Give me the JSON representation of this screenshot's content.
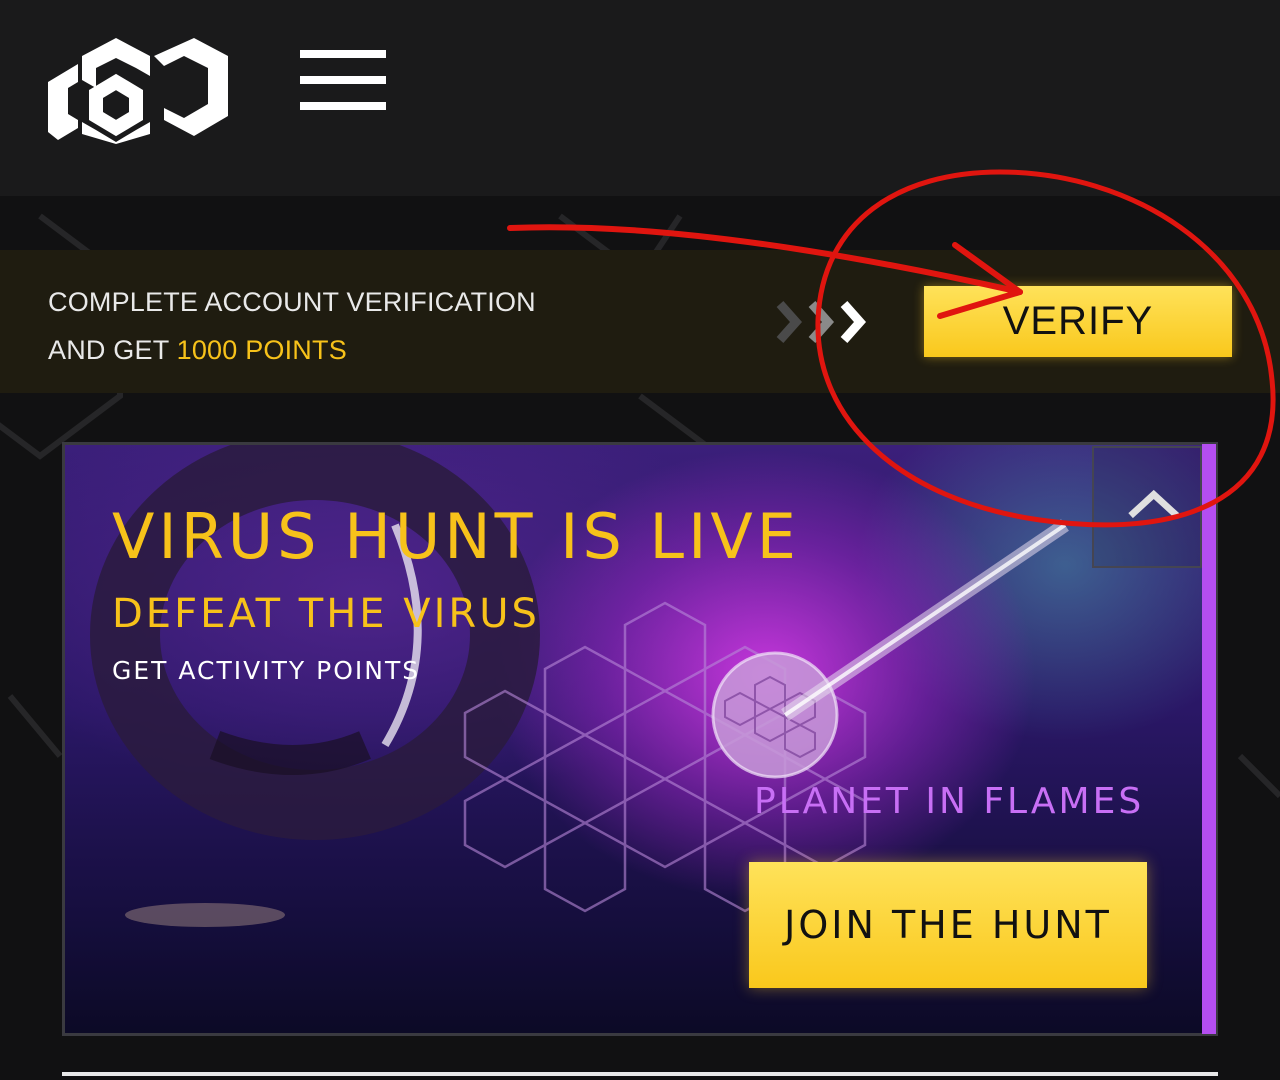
{
  "header": {
    "logo_icon": "brand-logo-icon",
    "menu_icon": "hamburger-menu-icon"
  },
  "verification_banner": {
    "line1": "COMPLETE ACCOUNT VERIFICATION",
    "line2_prefix": "AND GET ",
    "line2_points": "1000 POINTS",
    "chevrons_icon": "triple-chevron-right-icon",
    "button_label": "VERIFY"
  },
  "promo": {
    "title": "VIRUS HUNT IS LIVE",
    "subtitle": "DEFEAT THE VIRUS",
    "caption": "GET ACTIVITY POINTS",
    "game_name": "PLANET IN FLAMES",
    "button_label": "JOIN THE HUNT",
    "collapse_icon": "chevron-up-icon"
  },
  "colors": {
    "accent_yellow": "#f7c21a",
    "accent_purple": "#b44ef0",
    "annotation_red": "#e0150f",
    "header_bg": "#1a1a1b"
  }
}
